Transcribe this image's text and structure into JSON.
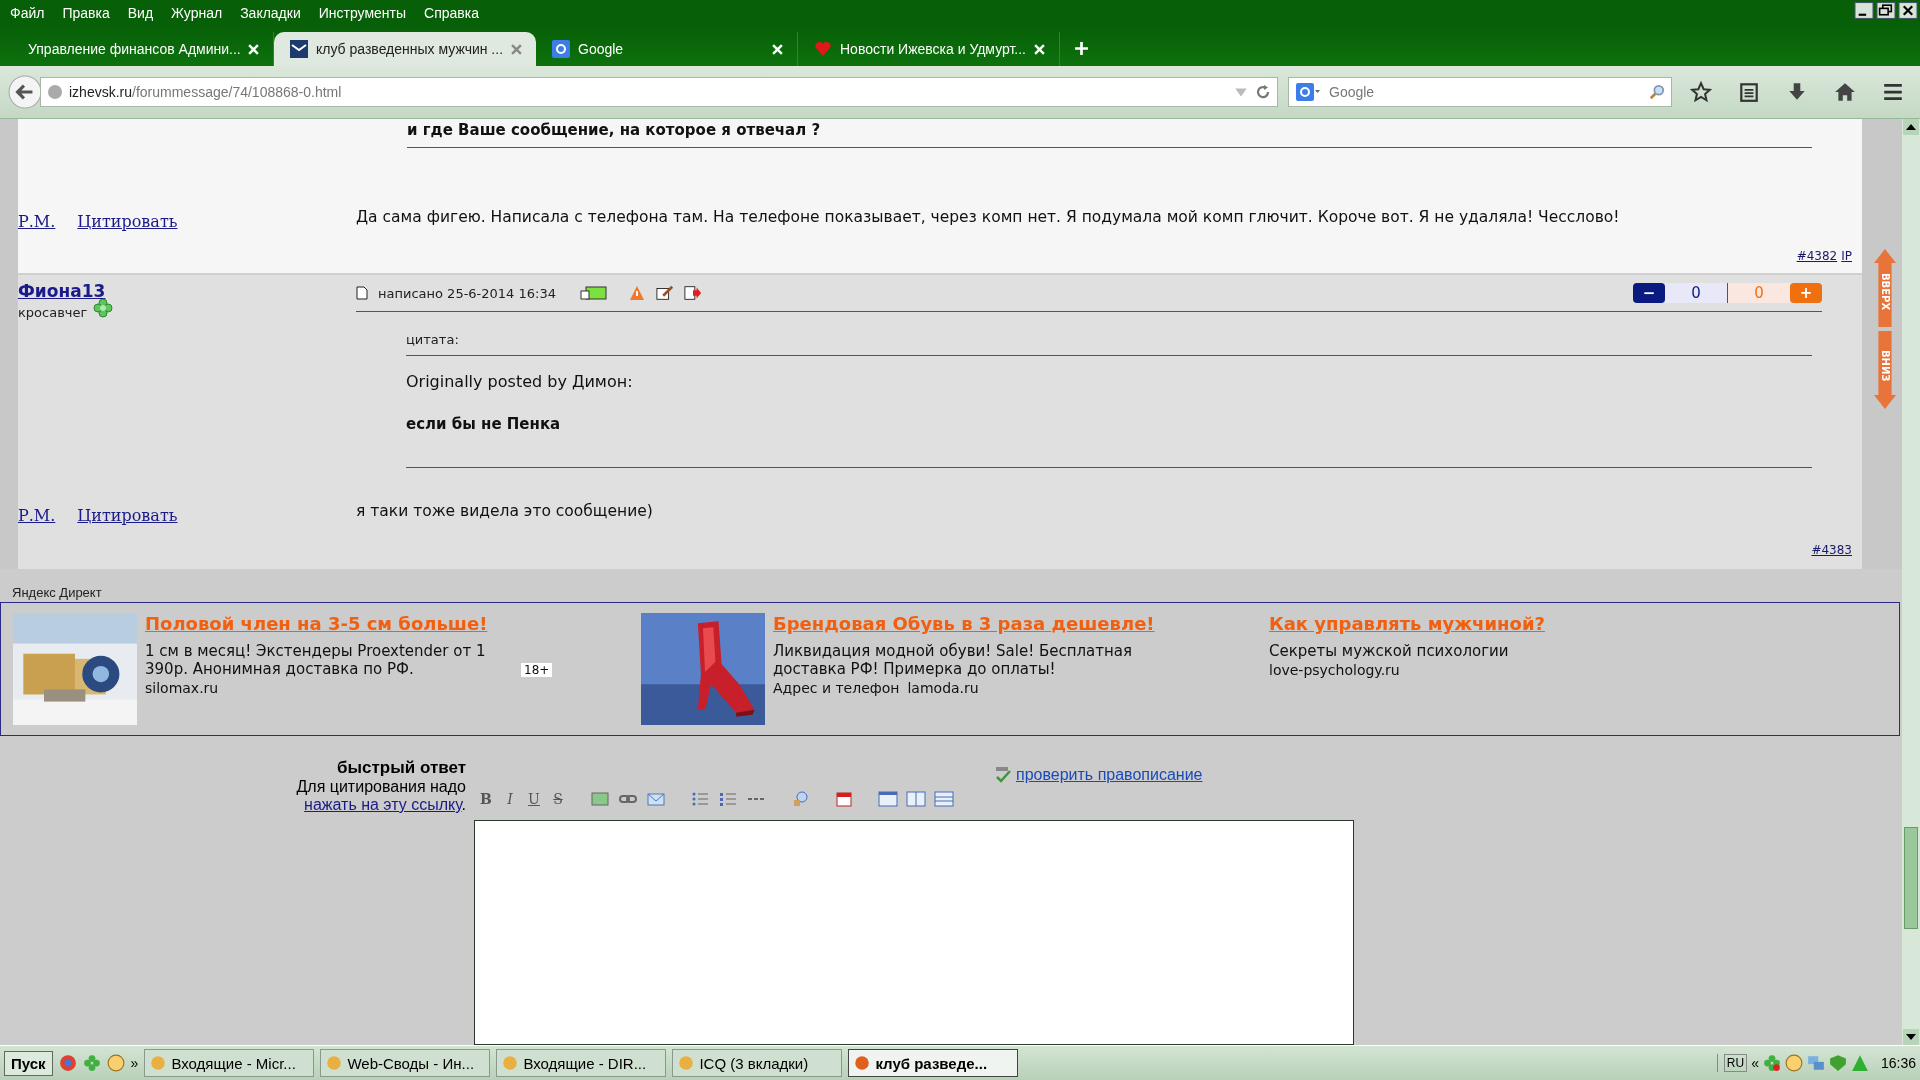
{
  "menu": [
    "Файл",
    "Правка",
    "Вид",
    "Журнал",
    "Закладки",
    "Инструменты",
    "Справка"
  ],
  "tabs": [
    {
      "label": "Управление финансов Админи...",
      "selected": false
    },
    {
      "label": "клуб разведенных мужчин ...",
      "selected": true
    },
    {
      "label": "Google",
      "selected": false
    },
    {
      "label": "Новости Ижевска и Удмурт...",
      "selected": false
    }
  ],
  "address": {
    "domain": "izhevsk.ru",
    "path": "/forummessage/74/108868-0.html"
  },
  "search": {
    "placeholder": "Google"
  },
  "post_1": {
    "quote_text": "и где Ваше сообщение, на которое я отвечал ?",
    "links": [
      "Р.М.",
      "Цитировать"
    ],
    "body": "Да сама фигею. Написала с телефона там. На телефоне показывает, через комп нет. Я подумала мой комп глючит. Короче вот. Я не удаляла! Чесслово!",
    "number": "#4382",
    "ip": "IP"
  },
  "post_2": {
    "author": "Фиона13",
    "rank": "кросавчег",
    "meta": "написано 25-6-2014 16:34",
    "rating": {
      "minus": "−",
      "negative": "0",
      "positive": "0",
      "plus": "+"
    },
    "quote_label": "цитата:",
    "quote_author": "Originally posted by Димон:",
    "quote_text": "если бы не Пенка",
    "links": [
      "Р.М.",
      "Цитировать"
    ],
    "body": "я таки тоже видела это сообщение)",
    "number": "#4383"
  },
  "side_buttons": [
    "ВВЕРХ",
    "ВНИЗ"
  ],
  "ads": {
    "label": "Яндекс Директ",
    "items": [
      {
        "kind": "picture",
        "title": "Половой член на 3-5 см больше!",
        "text": "1 см в месяц! Экстендеры Proextender от 1 390р. Анонимная доставка по РФ.",
        "badge": "18+",
        "domain": "silomax.ru"
      },
      {
        "kind": "picture",
        "title": "Брендовая Обувь в 3 раза дешевле!",
        "text": "Ликвидация модной обуви! Sale! Бесплатная доставка РФ! Примерка до оплаты!",
        "prefix": "Адрес и телефон",
        "domain": "lamoda.ru"
      },
      {
        "kind": "text",
        "title": "Как управлять мужчиной?",
        "text": "Секреты мужской психологии",
        "domain": "love-psychology.ru"
      }
    ]
  },
  "reply": {
    "title": "быстрый ответ",
    "hint": "Для цитирования надо",
    "link": "нажать на эту ссылку",
    "after_link": ".",
    "spellcheck": "проверить правописание",
    "toolbar": [
      "B",
      "I",
      "U",
      "S"
    ]
  },
  "taskbar": {
    "start": "Пуск",
    "more": "»",
    "tasks": [
      {
        "label": "Входящие - Micr...",
        "selected": false
      },
      {
        "label": "Web-Своды - Ин...",
        "selected": false
      },
      {
        "label": "Входящие - DIR...",
        "selected": false
      },
      {
        "label": "ICQ (3 вкладки)",
        "selected": false
      },
      {
        "label": "клуб разведе...",
        "selected": true
      }
    ],
    "lang": "RU",
    "collapse": "«",
    "time": "16:36"
  }
}
